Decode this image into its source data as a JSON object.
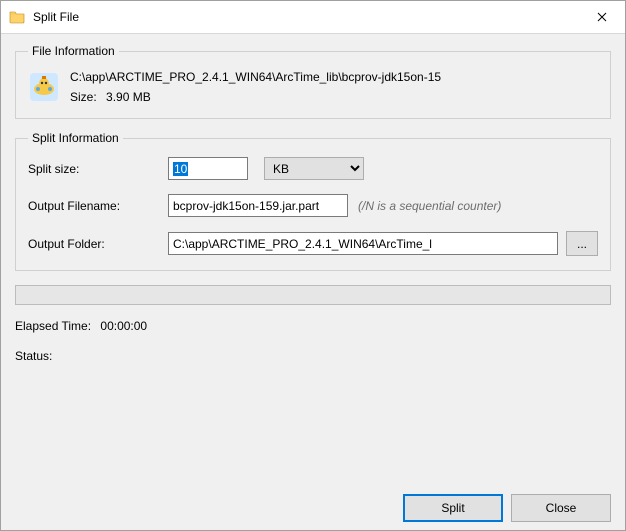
{
  "window": {
    "title": "Split File"
  },
  "file_info": {
    "legend": "File Information",
    "path": "C:\\app\\ARCTIME_PRO_2.4.1_WIN64\\ArcTime_lib\\bcprov-jdk15on-15",
    "size_label": "Size:",
    "size_value": "3.90 MB"
  },
  "split_info": {
    "legend": "Split Information",
    "size_label": "Split size:",
    "size_value": "10",
    "unit_value": "KB",
    "filename_label": "Output Filename:",
    "filename_value": "bcprov-jdk15on-159.jar.part",
    "filename_hint": "(/N is a sequential counter)",
    "folder_label": "Output Folder:",
    "folder_value": "C:\\app\\ARCTIME_PRO_2.4.1_WIN64\\ArcTime_l",
    "browse_label": "..."
  },
  "progress": {
    "value": 0
  },
  "elapsed": {
    "label": "Elapsed Time:",
    "value": "00:00:00"
  },
  "status": {
    "label": "Status:",
    "value": ""
  },
  "buttons": {
    "split": "Split",
    "close": "Close"
  }
}
